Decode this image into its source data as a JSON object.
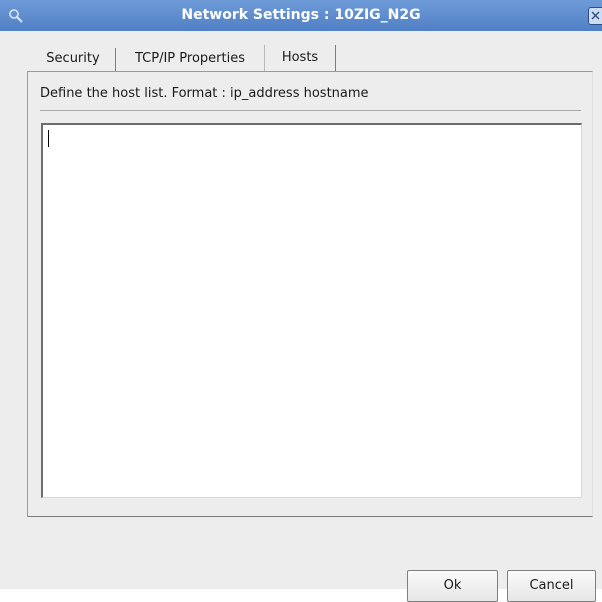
{
  "window": {
    "title": "Network Settings : 10ZIG_N2G",
    "icons": {
      "window_icon": "search-icon",
      "close": "close-icon"
    }
  },
  "tabs": [
    {
      "label": "Security",
      "active": false
    },
    {
      "label": "TCP/IP Properties",
      "active": false
    },
    {
      "label": "Hosts",
      "active": true
    }
  ],
  "hosts_panel": {
    "description": "Define the host list. Format : ip_address   hostname",
    "hosts_value": ""
  },
  "buttons": {
    "ok": "Ok",
    "cancel": "Cancel"
  },
  "colors": {
    "titlebar": "#5a88cc",
    "dialog_bg": "#ededed"
  }
}
